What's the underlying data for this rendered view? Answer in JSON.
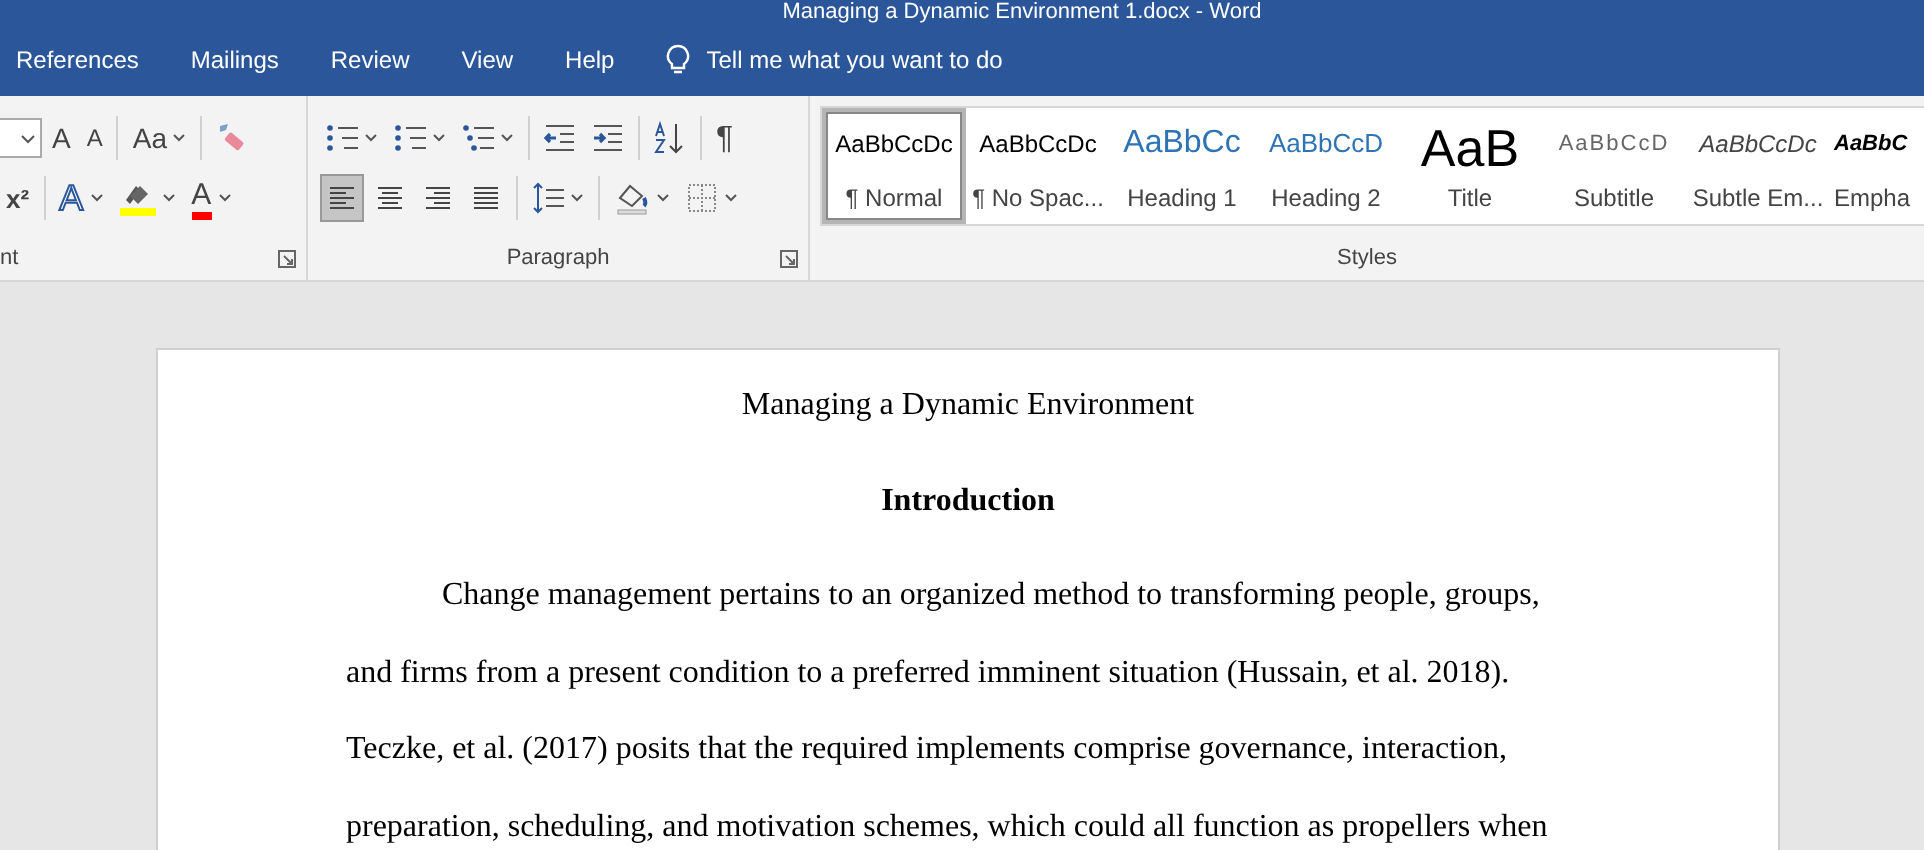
{
  "window": {
    "title": "Managing a Dynamic Environment 1.docx  -  Word"
  },
  "tabs": [
    {
      "label": "References",
      "selected": false
    },
    {
      "label": "Mailings",
      "selected": false
    },
    {
      "label": "Review",
      "selected": false
    },
    {
      "label": "View",
      "selected": false
    },
    {
      "label": "Help",
      "selected": false
    }
  ],
  "tell_me": {
    "placeholder": "Tell me what you want to do"
  },
  "ribbon": {
    "groups": [
      {
        "label": "nt",
        "launcher": true,
        "top_tools": [
          {
            "kind": "sizefield"
          },
          {
            "kind": "grow",
            "glyph": "A",
            "dropdown": false
          },
          {
            "kind": "shrink",
            "glyph": "A",
            "dropdown": false
          },
          {
            "kind": "sep"
          },
          {
            "kind": "case",
            "glyph": "Aa",
            "dropdown": true
          },
          {
            "kind": "sep"
          },
          {
            "kind": "eraser",
            "dropdown": false
          }
        ],
        "bottom_tools": [
          {
            "kind": "superscript",
            "glyph": "x²",
            "dropdown": false
          },
          {
            "kind": "sep"
          },
          {
            "kind": "effects",
            "glyph": "A",
            "dropdown": true
          },
          {
            "kind": "highlight",
            "dropdown": true,
            "color": "#ffff00"
          },
          {
            "kind": "fontcolor",
            "glyph": "A",
            "dropdown": true,
            "color": "#ff0000"
          }
        ]
      },
      {
        "label": "Paragraph",
        "launcher": true,
        "top_tools": [
          {
            "kind": "bullets",
            "dropdown": true
          },
          {
            "kind": "numbering",
            "dropdown": true
          },
          {
            "kind": "multilevel",
            "dropdown": true
          },
          {
            "kind": "sep"
          },
          {
            "kind": "outdent",
            "dropdown": false
          },
          {
            "kind": "indent",
            "dropdown": false
          },
          {
            "kind": "sep"
          },
          {
            "kind": "sort",
            "dropdown": false
          },
          {
            "kind": "sep"
          },
          {
            "kind": "pilcrow",
            "glyph": "¶",
            "dropdown": false
          }
        ],
        "bottom_tools": [
          {
            "kind": "alignleft",
            "dropdown": false,
            "selected": true
          },
          {
            "kind": "aligncenter",
            "dropdown": false,
            "selected": false
          },
          {
            "kind": "alignright",
            "dropdown": false,
            "selected": false
          },
          {
            "kind": "justify",
            "dropdown": false,
            "selected": false
          },
          {
            "kind": "sep"
          },
          {
            "kind": "spacing",
            "dropdown": true
          },
          {
            "kind": "sep"
          },
          {
            "kind": "shading",
            "dropdown": true
          },
          {
            "kind": "borders",
            "dropdown": true
          }
        ]
      }
    ]
  },
  "styles": {
    "label": "Styles",
    "items": [
      {
        "preview": "AaBbCcDc",
        "label": "¶ Normal",
        "kind": "normal",
        "selected": true
      },
      {
        "preview": "AaBbCcDc",
        "label": "¶ No Spac...",
        "kind": "nospacing",
        "selected": false
      },
      {
        "preview": "AaBbCc",
        "label": "Heading 1",
        "kind": "heading1",
        "selected": false
      },
      {
        "preview": "AaBbCcD",
        "label": "Heading 2",
        "kind": "heading2",
        "selected": false
      },
      {
        "preview": "AaB",
        "label": "Title",
        "kind": "title",
        "selected": false
      },
      {
        "preview": "AaBbCcD",
        "label": "Subtitle",
        "kind": "subtitle",
        "selected": false
      },
      {
        "preview": "AaBbCcDc",
        "label": "Subtle Em...",
        "kind": "subtle",
        "selected": false
      },
      {
        "preview": "AaBbC",
        "label": "Empha",
        "kind": "emphasis",
        "selected": false
      }
    ]
  },
  "document": {
    "title": "Managing a Dynamic Environment",
    "heading": "Introduction",
    "paragraph": "Change management pertains to an organized method to transforming people, groups, and firms from a present condition to a preferred imminent situation (Hussain, et al. 2018). Teczke, et al. (2017) posits that the required implements comprise governance, interaction, preparation, scheduling, and motivation schemes, which could all function as propellers when"
  }
}
